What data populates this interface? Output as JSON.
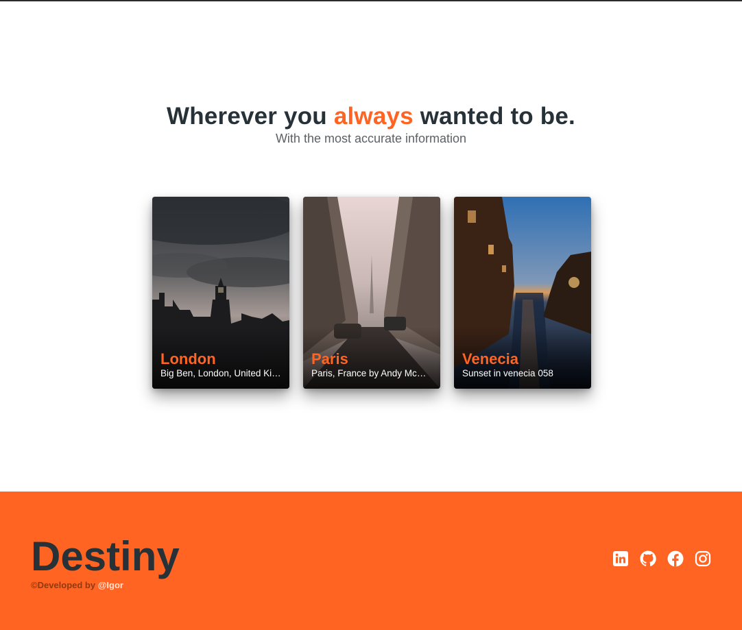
{
  "hero": {
    "title_before": "Wherever you ",
    "title_accent": "always",
    "title_after": " wanted to be.",
    "subtitle": "With the most accurate information"
  },
  "cards": [
    {
      "title": "London",
      "description": "Big Ben, London, United Kingdom"
    },
    {
      "title": "Paris",
      "description": "Paris, France by Andy McCune"
    },
    {
      "title": "Venecia",
      "description": "Sunset in venecia 058"
    }
  ],
  "footer": {
    "brand": "Destiny",
    "credit_prefix": "©Developed by ",
    "credit_handle": "@Igor",
    "socials": [
      "linkedin-icon",
      "github-icon",
      "facebook-icon",
      "instagram-icon"
    ]
  },
  "colors": {
    "accent": "#ff6422",
    "heading": "#263238",
    "footer_bg": "#ff6422"
  }
}
